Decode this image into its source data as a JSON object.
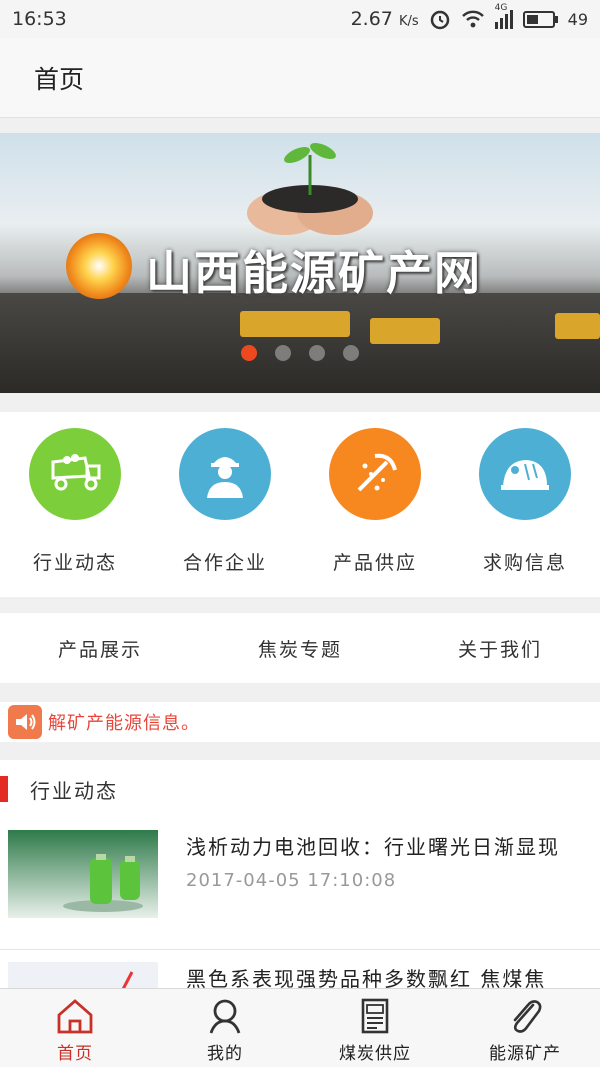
{
  "status_bar": {
    "time": "16:53",
    "net_speed": "2.67",
    "net_unit": "K/s",
    "network": "4G",
    "battery": "49"
  },
  "header": {
    "title": "首页"
  },
  "banner": {
    "title": "山西能源矿产网",
    "slides_total": 4,
    "active_slide": 1
  },
  "categories": [
    {
      "label": "行业动态",
      "color": "#7ccf3a",
      "icon": "dump-truck-icon"
    },
    {
      "label": "合作企业",
      "color": "#4eafd4",
      "icon": "worker-helmet-icon"
    },
    {
      "label": "产品供应",
      "color": "#f7871f",
      "icon": "pickaxe-icon"
    },
    {
      "label": "求购信息",
      "color": "#4eafd4",
      "icon": "mining-helmet-icon"
    }
  ],
  "tabs": [
    {
      "label": "产品展示"
    },
    {
      "label": "焦炭专题"
    },
    {
      "label": "关于我们"
    }
  ],
  "notice": {
    "text": "解矿产能源信息。",
    "icon": "speaker-icon"
  },
  "news": {
    "section_title": "行业动态",
    "items": [
      {
        "title": "浅析动力电池回收：行业曙光日渐显现",
        "time": "2017-04-05 17:10:08"
      },
      {
        "title": "黑色系表现强势品种多数飘红 焦煤焦",
        "time": ""
      }
    ]
  },
  "bottom_nav": [
    {
      "label": "首页",
      "icon": "home-icon",
      "active": true
    },
    {
      "label": "我的",
      "icon": "user-icon",
      "active": false
    },
    {
      "label": "煤炭供应",
      "icon": "supply-document-icon",
      "active": false
    },
    {
      "label": "能源矿产",
      "icon": "paperclip-icon",
      "active": false
    }
  ],
  "colors": {
    "accent": "#c8302a",
    "notice_text": "#e8463a",
    "section_bar": "#e32b24",
    "dot_active": "#ec4a1e"
  }
}
